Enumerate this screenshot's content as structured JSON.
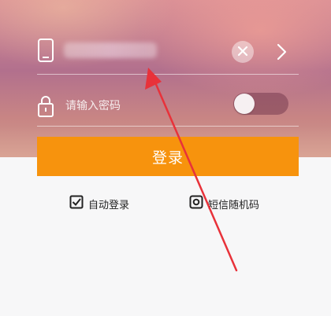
{
  "account": {
    "clear_icon": "close-icon",
    "next_icon": "chevron-right-icon"
  },
  "password": {
    "placeholder": "请输入密码",
    "toggle_on": false
  },
  "login_button": {
    "label": "登录"
  },
  "options": {
    "auto_login": {
      "label": "自动登录",
      "checked": true
    },
    "sms_code": {
      "label": "短信随机码"
    }
  },
  "annotation": {
    "color": "#e8323a"
  }
}
